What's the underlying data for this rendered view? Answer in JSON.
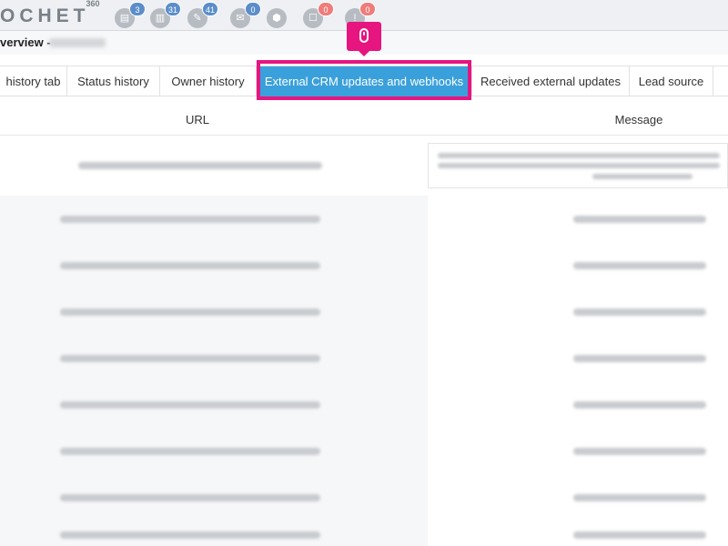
{
  "app": {
    "logo_text": "OCHET",
    "logo_sup": "360"
  },
  "topbar_icons": [
    {
      "name": "document-icon",
      "count": "3",
      "badge_color": "#5b8ec9"
    },
    {
      "name": "file-icon",
      "count": "31",
      "badge_color": "#5b8ec9"
    },
    {
      "name": "chat-icon",
      "count": "41",
      "badge_color": "#5b8ec9"
    },
    {
      "name": "mail-icon",
      "count": "0",
      "badge_color": "#5b8ec9"
    },
    {
      "name": "box-icon",
      "count": "",
      "badge_color": ""
    },
    {
      "name": "speech-icon",
      "count": "0",
      "badge_color": "#ef7b7b"
    },
    {
      "name": "alert-icon",
      "count": "0",
      "badge_color": "#ef7b7b"
    }
  ],
  "header": {
    "title": "verview -"
  },
  "tabs": [
    {
      "label": "history tab",
      "active": false
    },
    {
      "label": "Status history",
      "active": false
    },
    {
      "label": "Owner history",
      "active": false
    },
    {
      "label": "External CRM updates and webhooks",
      "active": true
    },
    {
      "label": "Received external updates",
      "active": false
    },
    {
      "label": "Lead source",
      "active": false
    }
  ],
  "table": {
    "columns": [
      "URL",
      "Message"
    ]
  },
  "colors": {
    "accent": "#3aa0db",
    "highlight": "#e6157f"
  }
}
